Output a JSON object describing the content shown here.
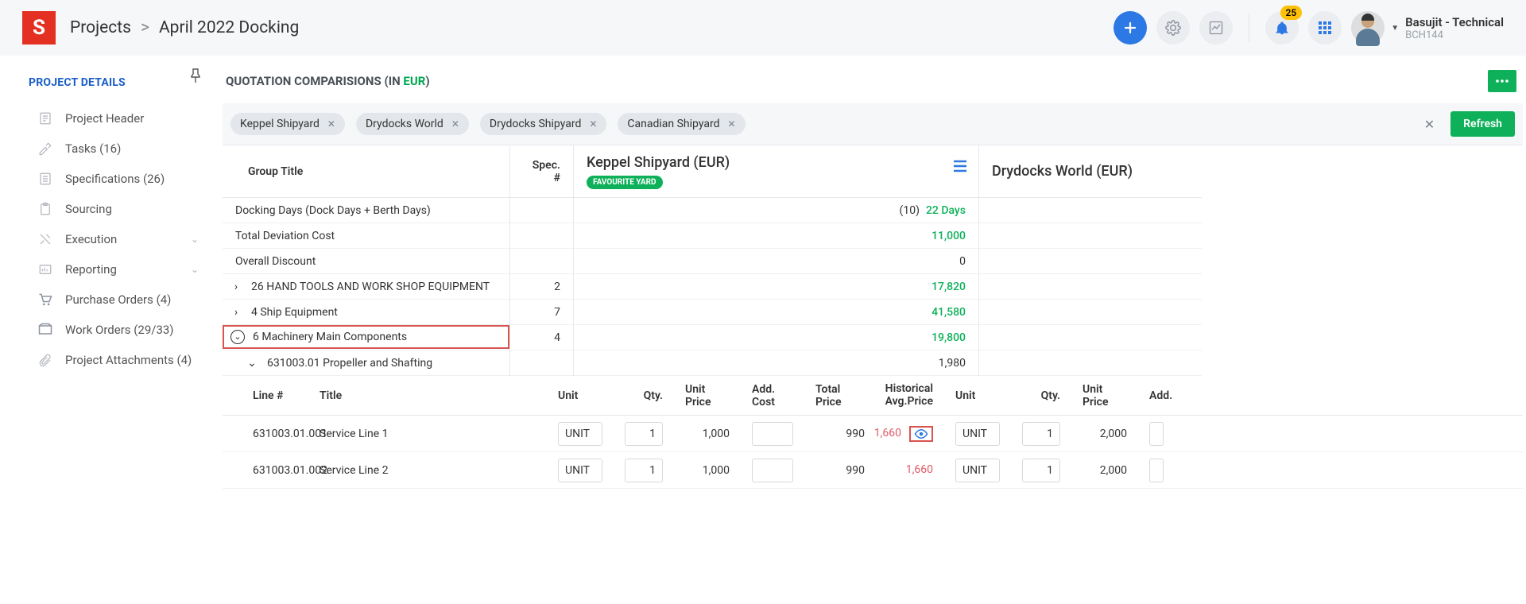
{
  "header": {
    "logo_letter": "S",
    "breadcrumb_root": "Projects",
    "breadcrumb_sep": ">",
    "breadcrumb_page": "April 2022 Docking",
    "notification_count": "25",
    "user_name": "Basujit - Technical",
    "user_id": "BCH144"
  },
  "sidebar": {
    "title": "PROJECT DETAILS",
    "items": [
      {
        "label": "Project Header",
        "has_chevron": false
      },
      {
        "label": "Tasks (16)",
        "has_chevron": false
      },
      {
        "label": "Specifications (26)",
        "has_chevron": false
      },
      {
        "label": "Sourcing",
        "has_chevron": false
      },
      {
        "label": "Execution",
        "has_chevron": true
      },
      {
        "label": "Reporting",
        "has_chevron": true
      },
      {
        "label": "Purchase Orders (4)",
        "has_chevron": false
      },
      {
        "label": "Work Orders (29/33)",
        "has_chevron": false
      },
      {
        "label": "Project Attachments (4)",
        "has_chevron": false
      }
    ]
  },
  "section": {
    "title_a": "QUOTATION COMPARISIONS (IN ",
    "title_b": "EUR",
    "title_c": ")"
  },
  "filters": {
    "chips": [
      "Keppel Shipyard",
      "Drydocks World",
      "Drydocks Shipyard",
      "Canadian Shipyard"
    ],
    "refresh_label": "Refresh"
  },
  "table": {
    "headers": {
      "group_title": "Group Title",
      "spec_no": "Spec. #",
      "vendor_a": "Keppel Shipyard (EUR)",
      "vendor_a_badge": "FAVOURITE YARD",
      "vendor_b": "Drydocks World (EUR)"
    },
    "rows": [
      {
        "title": "Docking Days (Dock Days + Berth Days)",
        "spec": "",
        "val_a_prefix": "(10)",
        "val_a": "22 Days"
      },
      {
        "title": "Total Deviation Cost",
        "spec": "",
        "val_a": "11,000"
      },
      {
        "title": "Overall Discount",
        "spec": "",
        "val_a": "0",
        "plain": true
      },
      {
        "title": "26 HAND TOOLS AND WORK SHOP EQUIPMENT",
        "spec": "2",
        "val_a": "17,820",
        "expandable": true
      },
      {
        "title": "4 Ship Equipment",
        "spec": "7",
        "val_a": "41,580",
        "expandable": true
      },
      {
        "title": "6 Machinery Main Components",
        "spec": "4",
        "val_a": "19,800",
        "expandable": true,
        "open": true,
        "highlight": true
      },
      {
        "title": "631003.01 Propeller and Shafting",
        "spec": "",
        "val_a": "1,980",
        "sub": true,
        "plain": true
      }
    ],
    "sub_headers": {
      "line": "Line #",
      "title": "Title",
      "unit": "Unit",
      "qty": "Qty.",
      "unit_price": "Unit Price",
      "add_cost": "Add. Cost",
      "total_price": "Total Price",
      "hap": "Historical Avg.Price",
      "add_cost_short": "Add."
    },
    "data_rows": [
      {
        "line": "631003.01.001",
        "title": "Service Line 1",
        "unit": "UNIT",
        "qty": "1",
        "unit_price": "1,000",
        "add": "",
        "total": "990",
        "hap": "1,660",
        "show_eye": true,
        "b_unit": "UNIT",
        "b_qty": "1",
        "b_up": "2,000"
      },
      {
        "line": "631003.01.002",
        "title": "Service Line 2",
        "unit": "UNIT",
        "qty": "1",
        "unit_price": "1,000",
        "add": "",
        "total": "990",
        "hap": "1,660",
        "show_eye": false,
        "b_unit": "UNIT",
        "b_qty": "1",
        "b_up": "2,000"
      }
    ]
  }
}
